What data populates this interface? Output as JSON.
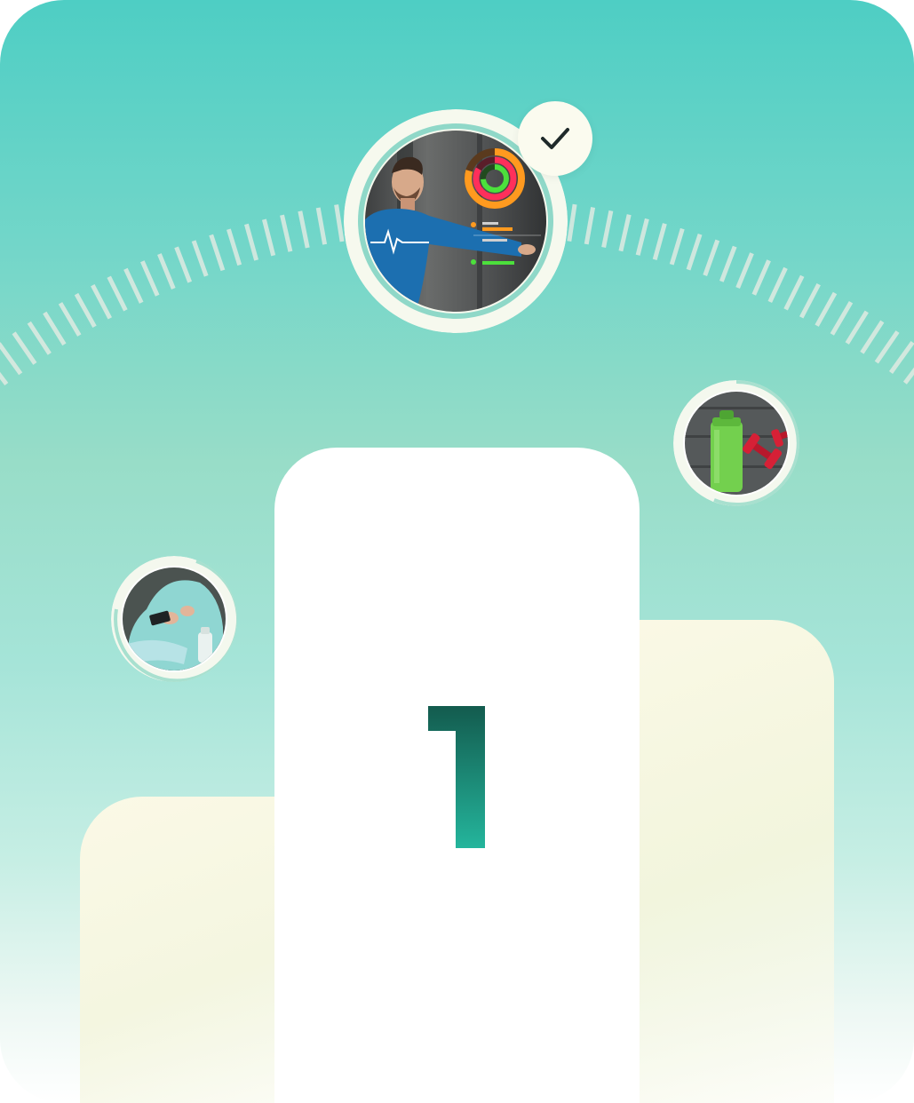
{
  "podium": {
    "first_place_rank": "1"
  },
  "icons": {
    "check": "check-icon"
  },
  "colors": {
    "teal_top": "#4ecec4",
    "mint": "#98ddc8",
    "cream": "#fbf9e6",
    "number_dark": "#135b4e",
    "number_light": "#23b29a",
    "ring_light": "#f4f8ee"
  }
}
